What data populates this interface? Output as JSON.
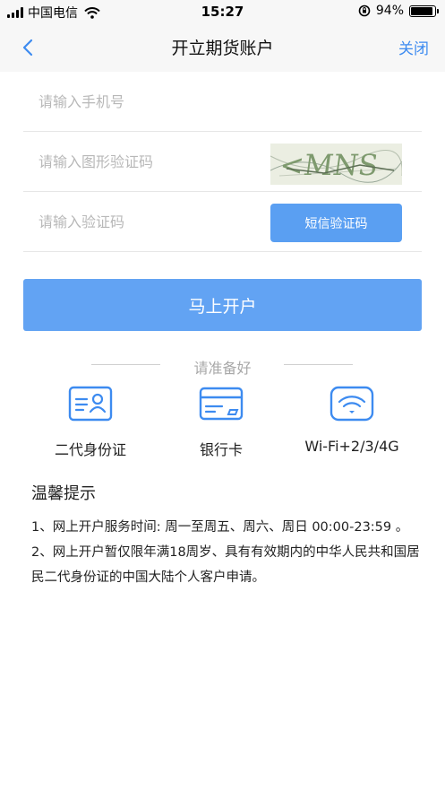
{
  "status_bar": {
    "carrier": "中国电信",
    "time": "15:27",
    "battery": "94%",
    "battery_level": 0.94
  },
  "nav": {
    "title": "开立期货账户",
    "close_label": "关闭"
  },
  "form": {
    "phone_placeholder": "请输入手机号",
    "image_code_placeholder": "请输入图形验证码",
    "sms_code_placeholder": "请输入验证码",
    "sms_button_label": "短信验证码",
    "captcha_text": "<MNS"
  },
  "submit_label": "马上开户",
  "prepare": {
    "title": "请准备好",
    "items": [
      {
        "label": "二代身份证",
        "icon": "id-card-icon"
      },
      {
        "label": "银行卡",
        "icon": "bank-card-icon"
      },
      {
        "label": "Wi-Fi+2/3/4G",
        "icon": "wifi-icon"
      }
    ]
  },
  "tips": {
    "title": "温馨提示",
    "items": [
      "1、网上开户服务时间: 周一至周五、周六、周日 00:00-23:59 。",
      "2、网上开户暂仅限年满18周岁、具有有效期内的中华人民共和国居民二代身份证的中国大陆个人客户申请。"
    ]
  },
  "colors": {
    "accent": "#3d8bf0",
    "button": "#62a3f3",
    "sms_button": "#5a9ff2"
  }
}
